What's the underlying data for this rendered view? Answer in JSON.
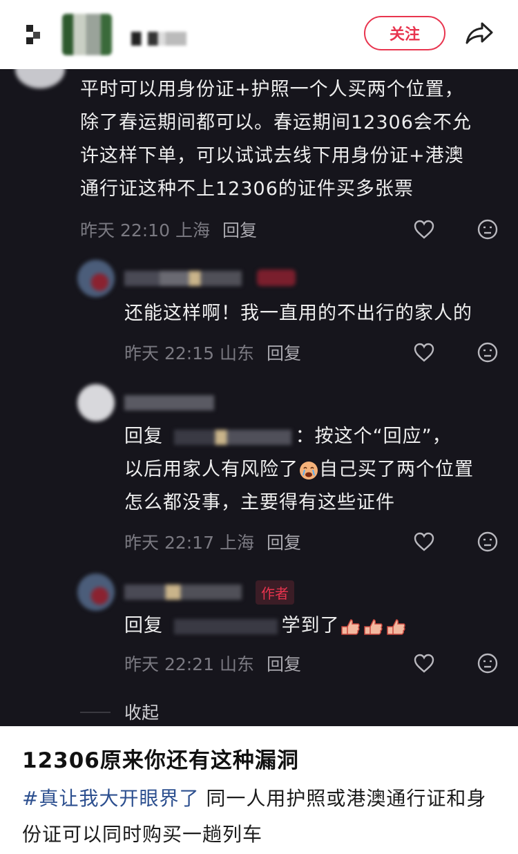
{
  "header": {
    "follow_label": "关注"
  },
  "comments": [
    {
      "text_lines": [
        "平时可以用身份证+护照一个人买两个位置，",
        "除了春运期间都可以。春运期间12306会不允",
        "许这样下单，可以试试去线下用身份证+港澳",
        "通行证这种不上12306的证件买多张票"
      ],
      "time": "昨天 22:10",
      "location": "上海",
      "reply_label": "回复"
    },
    {
      "text": "还能这样啊！我一直用的不出行的家人的",
      "time": "昨天 22:15",
      "location": "山东",
      "reply_label": "回复"
    },
    {
      "reply_prefix": "回复",
      "reply_suffix": "：按这个“回应”，",
      "line2_before": "以后用家人有风险了",
      "line2_after": "自己买了两个位置",
      "line3": "怎么都没事，主要得有这些证件",
      "time": "昨天 22:17",
      "location": "上海",
      "reply_label": "回复"
    },
    {
      "author_tag": "作者",
      "reply_prefix": "回复",
      "text": "学到了",
      "time": "昨天 22:21",
      "location": "山东",
      "reply_label": "回复"
    }
  ],
  "collapse_label": "收起",
  "post": {
    "title": "12306原来你还有这种漏洞",
    "hashtag": "#真让我大开眼界了",
    "description": " 同一人用护照或港澳通行证和身份证可以同时购买一趟列车"
  },
  "colors": {
    "accent": "#e8344e",
    "dark_bg": "#16151c",
    "hashtag": "#2c4f8f"
  }
}
